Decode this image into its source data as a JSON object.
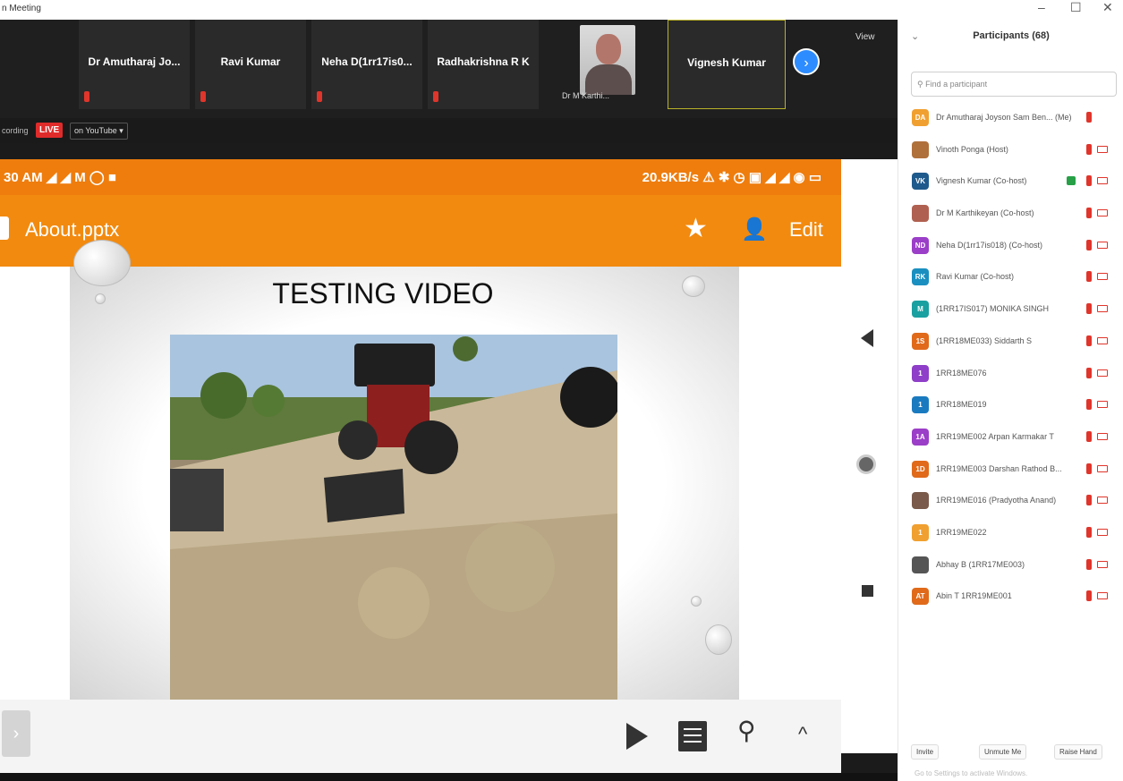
{
  "window": {
    "title": "n Meeting",
    "minimize": "–",
    "restore": "☐",
    "close": "✕"
  },
  "strip": {
    "tiles": [
      {
        "name": "Dr Amutharaj Jo..."
      },
      {
        "name": "Ravi Kumar"
      },
      {
        "name": "Neha D(1rr17is0..."
      },
      {
        "name": "Radhakrishna R K"
      }
    ],
    "photo_tile_name": "Dr M Karthi...",
    "active_tile_name": "Vignesh Kumar",
    "next_icon": "chevron-right-icon",
    "view_label": "View"
  },
  "livebar": {
    "recording_label": "cording",
    "live_label": "LIVE",
    "youtube_label": "on YouTube ▾"
  },
  "phone": {
    "status_time": "30 AM",
    "status_icons": "◢ ◢ M ◯ ■",
    "status_right": "20.9KB/s ⚠ ✱ ◷ ▣ ◢ ◢ ◉ ▭",
    "doc_title": "About.pptx",
    "star_icon": "★",
    "edit_label": "Edit",
    "slide_title": "TESTING VIDEO"
  },
  "participants": {
    "header": "Participants (68)",
    "search_placeholder": "Find a participant",
    "rows": [
      {
        "initials": "DA",
        "name": "Dr Amutharaj Joyson Sam Ben... (Me)",
        "color": "#f0a030",
        "photo": false,
        "share": false,
        "cam": false
      },
      {
        "initials": "",
        "name": "Vinoth Ponga (Host)",
        "color": "#b0703a",
        "photo": true,
        "share": false,
        "cam": true
      },
      {
        "initials": "VK",
        "name": "Vignesh Kumar (Co-host)",
        "color": "#1e5a8c",
        "photo": false,
        "share": true,
        "cam": true
      },
      {
        "initials": "",
        "name": "Dr M Karthikeyan (Co-host)",
        "color": "#b06050",
        "photo": true,
        "share": false,
        "cam": true
      },
      {
        "initials": "ND",
        "name": "Neha D(1rr17is018) (Co-host)",
        "color": "#9b3ec8",
        "photo": false,
        "share": false,
        "cam": true
      },
      {
        "initials": "RK",
        "name": "Ravi Kumar (Co-host)",
        "color": "#1a8fc0",
        "photo": false,
        "share": false,
        "cam": true
      },
      {
        "initials": "M",
        "name": "(1RR17IS017) MONIKA SINGH",
        "color": "#1aa0a0",
        "photo": false,
        "share": false,
        "cam": true
      },
      {
        "initials": "1S",
        "name": "(1RR18ME033) Siddarth S",
        "color": "#e06a1a",
        "photo": false,
        "share": false,
        "cam": true
      },
      {
        "initials": "1",
        "name": "1RR18ME076",
        "color": "#8e3ec8",
        "photo": false,
        "share": false,
        "cam": true
      },
      {
        "initials": "1",
        "name": "1RR18ME019",
        "color": "#1a7ac0",
        "photo": false,
        "share": false,
        "cam": true
      },
      {
        "initials": "1A",
        "name": "1RR19ME002 Arpan Karmakar T",
        "color": "#9b3ec8",
        "photo": false,
        "share": false,
        "cam": true
      },
      {
        "initials": "1D",
        "name": "1RR19ME003 Darshan Rathod B...",
        "color": "#e06a1a",
        "photo": false,
        "share": false,
        "cam": true
      },
      {
        "initials": "",
        "name": "1RR19ME016 (Pradyotha Anand)",
        "color": "#7a5a4a",
        "photo": true,
        "share": false,
        "cam": true
      },
      {
        "initials": "1",
        "name": "1RR19ME022",
        "color": "#f0a030",
        "photo": false,
        "share": false,
        "cam": true
      },
      {
        "initials": "",
        "name": "Abhay B (1RR17ME003)",
        "color": "#555555",
        "photo": true,
        "share": false,
        "cam": true
      },
      {
        "initials": "AT",
        "name": "Abin T 1RR19ME001",
        "color": "#e06a1a",
        "photo": false,
        "share": false,
        "cam": true
      }
    ],
    "footer": {
      "invite": "Invite",
      "mute_all": "Unmute Me",
      "raise_hand": "Raise Hand"
    },
    "watermark": "Go to Settings to activate Windows."
  }
}
